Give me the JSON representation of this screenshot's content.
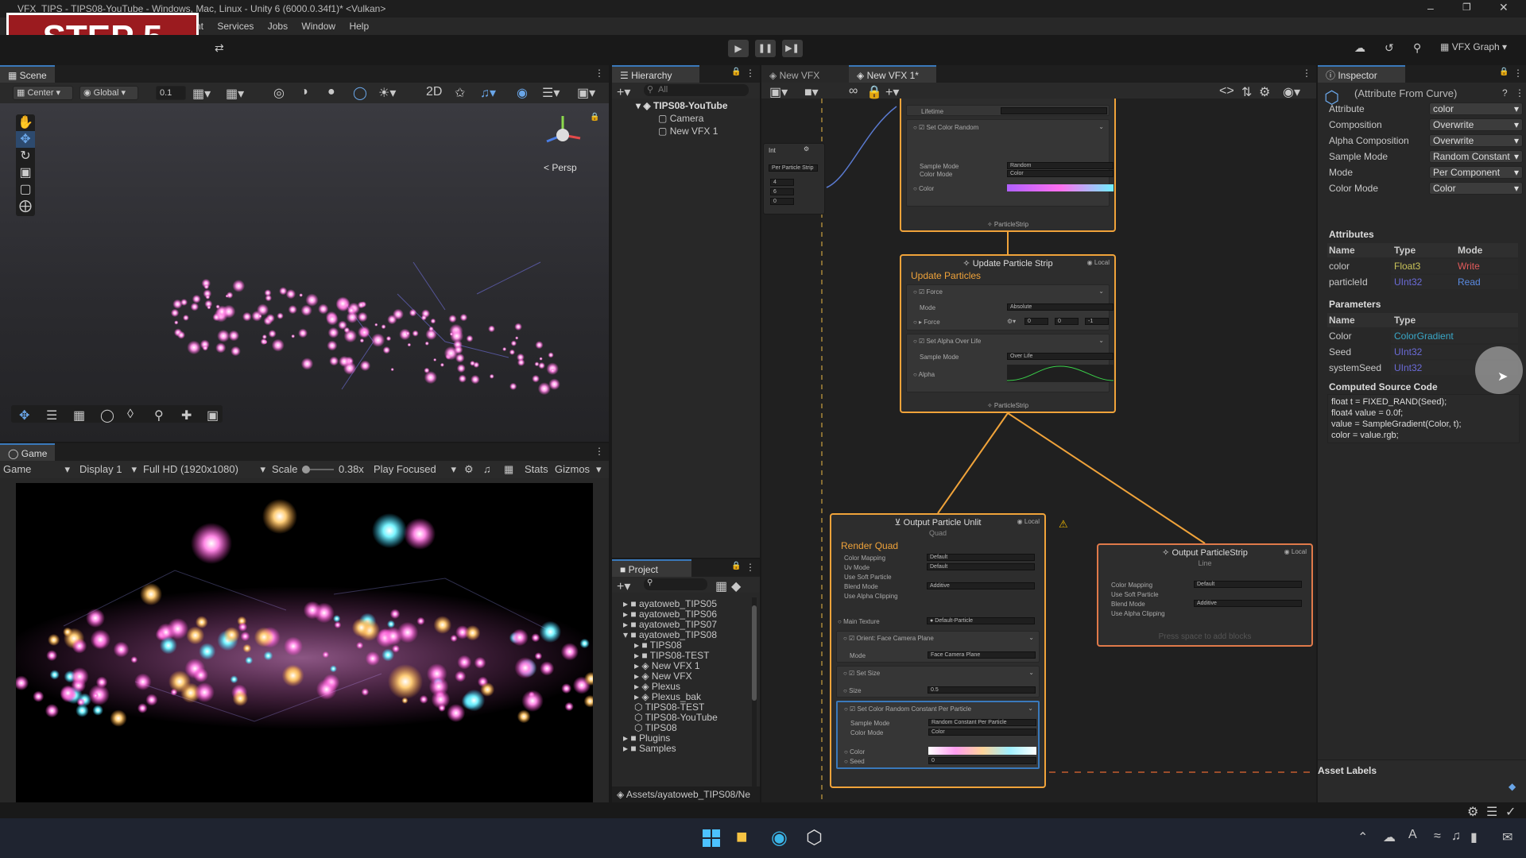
{
  "window": {
    "title": "VFX_TIPS - TIPS08-YouTube - Windows, Mac, Linux - Unity 6 (6000.0.34f1)* <Vulkan>"
  },
  "overlay": {
    "step": "STEP 5"
  },
  "menu": [
    "nt",
    "Services",
    "Jobs",
    "Window",
    "Help"
  ],
  "toolbar": {
    "vfx_graph": "VFX Graph"
  },
  "scene": {
    "tab": "Scene",
    "center": "Center",
    "global": "Global",
    "snap": "0.1",
    "persp": "Persp"
  },
  "game": {
    "tab": "Game",
    "view": "Game",
    "display": "Display 1",
    "resolution": "Full HD (1920x1080)",
    "scale_label": "Scale",
    "scale_value": "0.38x",
    "play_mode": "Play Focused",
    "stats": "Stats",
    "gizmos": "Gizmos"
  },
  "hierarchy": {
    "tab": "Hierarchy",
    "search_placeholder": "All",
    "items": [
      "TIPS08-YouTube",
      "Camera",
      "New VFX 1"
    ]
  },
  "project": {
    "tab": "Project",
    "items": [
      {
        "label": "ayatoweb_TIPS05",
        "indent": 0,
        "kind": "folder"
      },
      {
        "label": "ayatoweb_TIPS06",
        "indent": 0,
        "kind": "folder"
      },
      {
        "label": "ayatoweb_TIPS07",
        "indent": 0,
        "kind": "folder"
      },
      {
        "label": "ayatoweb_TIPS08",
        "indent": 0,
        "kind": "folder-open"
      },
      {
        "label": "TIPS08",
        "indent": 1,
        "kind": "folder"
      },
      {
        "label": "TIPS08-TEST",
        "indent": 1,
        "kind": "folder"
      },
      {
        "label": "New VFX 1",
        "indent": 1,
        "kind": "vfx"
      },
      {
        "label": "New VFX",
        "indent": 1,
        "kind": "vfx"
      },
      {
        "label": "Plexus",
        "indent": 1,
        "kind": "vfx"
      },
      {
        "label": "Plexus_bak",
        "indent": 1,
        "kind": "vfx"
      },
      {
        "label": "TIPS08-TEST",
        "indent": 1,
        "kind": "scene"
      },
      {
        "label": "TIPS08-YouTube",
        "indent": 1,
        "kind": "scene"
      },
      {
        "label": "TIPS08",
        "indent": 1,
        "kind": "scene"
      },
      {
        "label": "Plugins",
        "indent": 0,
        "kind": "folder"
      },
      {
        "label": "Samples",
        "indent": 0,
        "kind": "folder"
      }
    ],
    "path": "Assets/ayatoweb_TIPS08/Ne"
  },
  "vfx": {
    "tabs": [
      "New VFX",
      "New VFX 1*"
    ],
    "lifetime": "Lifetime",
    "side_node": {
      "type": "Int",
      "mode": "Per Particle Strip",
      "values": [
        "4",
        "6",
        "0"
      ]
    },
    "set_color_random": {
      "title": "Set Color Random",
      "sample_mode_label": "Sample Mode",
      "sample_mode": "Random",
      "color_mode_label": "Color Mode",
      "color_mode": "Color",
      "color_label": "Color",
      "footer": "ParticleStrip"
    },
    "update": {
      "title": "Update Particle Strip",
      "subtitle": "Update Particles",
      "local": "Local",
      "force_block": "Force",
      "mode_label": "Mode",
      "mode": "Absolute",
      "force_label": "Force",
      "force_x": "0",
      "force_y": "0",
      "force_z": "-1",
      "alpha_block": "Set Alpha Over Life",
      "alpha_sample_label": "Sample Mode",
      "alpha_sample": "Over Life",
      "alpha_label": "Alpha",
      "footer": "ParticleStrip"
    },
    "output_quad": {
      "title": "Output Particle Unlit",
      "subtitle": "Quad",
      "render": "Render Quad",
      "local": "Local",
      "fields": [
        [
          "Color Mapping",
          "Default"
        ],
        [
          "Uv Mode",
          "Default"
        ],
        [
          "Use Soft Particle",
          ""
        ],
        [
          "Blend Mode",
          "Additive"
        ],
        [
          "Use Alpha Clipping",
          ""
        ]
      ],
      "main_texture_label": "Main Texture",
      "main_texture": "Default-Particle",
      "orient": "Orient: Face Camera Plane",
      "orient_mode_label": "Mode",
      "orient_mode": "Face Camera Plane",
      "set_size": "Set Size",
      "size_label": "Size",
      "size": "0.5",
      "set_color": "Set Color Random Constant Per Particle",
      "sc_sample_label": "Sample Mode",
      "sc_sample": "Random Constant Per Particle",
      "sc_color_mode_label": "Color Mode",
      "sc_color_mode": "Color",
      "sc_color_label": "Color",
      "sc_seed_label": "Seed",
      "sc_seed": "0"
    },
    "output_strip": {
      "title": "Output ParticleStrip",
      "subtitle": "Line",
      "local": "Local",
      "fields": [
        [
          "Color Mapping",
          "Default"
        ],
        [
          "Use Soft Particle",
          ""
        ],
        [
          "Blend Mode",
          "Additive"
        ],
        [
          "Use Alpha Clipping",
          ""
        ]
      ],
      "hint": "Press space to add blocks"
    }
  },
  "inspector": {
    "tab": "Inspector",
    "title": "(Attribute From Curve)",
    "props": [
      [
        "Attribute",
        "color"
      ],
      [
        "Composition",
        "Overwrite"
      ],
      [
        "Alpha Composition",
        "Overwrite"
      ],
      [
        "Sample Mode",
        "Random Constant"
      ],
      [
        "Mode",
        "Per Component"
      ],
      [
        "Color Mode",
        "Color"
      ]
    ],
    "attributes_header": "Attributes",
    "attr_cols": [
      "Name",
      "Type",
      "Mode"
    ],
    "attr_rows": [
      [
        "color",
        "Float3",
        "Write"
      ],
      [
        "particleId",
        "UInt32",
        "Read"
      ]
    ],
    "parameters_header": "Parameters",
    "param_cols": [
      "Name",
      "Type"
    ],
    "param_rows": [
      [
        "Color",
        "ColorGradient"
      ],
      [
        "Seed",
        "UInt32"
      ],
      [
        "systemSeed",
        "UInt32"
      ]
    ],
    "code_header": "Computed Source Code",
    "code": [
      "float t = FIXED_RAND(Seed);",
      "float4 value = 0.0f;",
      "value = SampleGradient(Color, t);",
      "color = value.rgb;"
    ],
    "asset_labels": "Asset Labels"
  },
  "colors": {
    "accent": "#f0a33a",
    "tab_accent": "#3a79bb",
    "step_bg": "#9b1b1f",
    "float3": "#c9c35a",
    "uint32": "#6b6bd8",
    "write": "#e05a5a",
    "read": "#5a8ae0",
    "gradient": "#3aa8c8"
  }
}
